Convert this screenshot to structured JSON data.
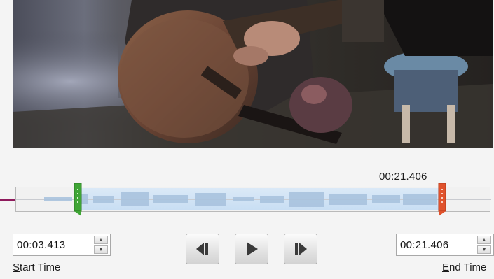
{
  "timeline": {
    "current_time": "00:21.406"
  },
  "start": {
    "value": "00:03.413",
    "caption_first": "S",
    "caption_rest": "tart Time",
    "up_icon": "triangle-up",
    "down_icon": "triangle-down"
  },
  "end": {
    "value": "00:21.406",
    "caption_first": "E",
    "caption_rest": "nd Time",
    "up_icon": "triangle-up",
    "down_icon": "triangle-down"
  },
  "transport": {
    "previous_frame_icon": "previous-frame-icon",
    "play_icon": "play-icon",
    "next_frame_icon": "next-frame-icon"
  },
  "colors": {
    "start_handle": "#3fa535",
    "end_handle": "#e0522c",
    "selection": "#c8def3"
  }
}
